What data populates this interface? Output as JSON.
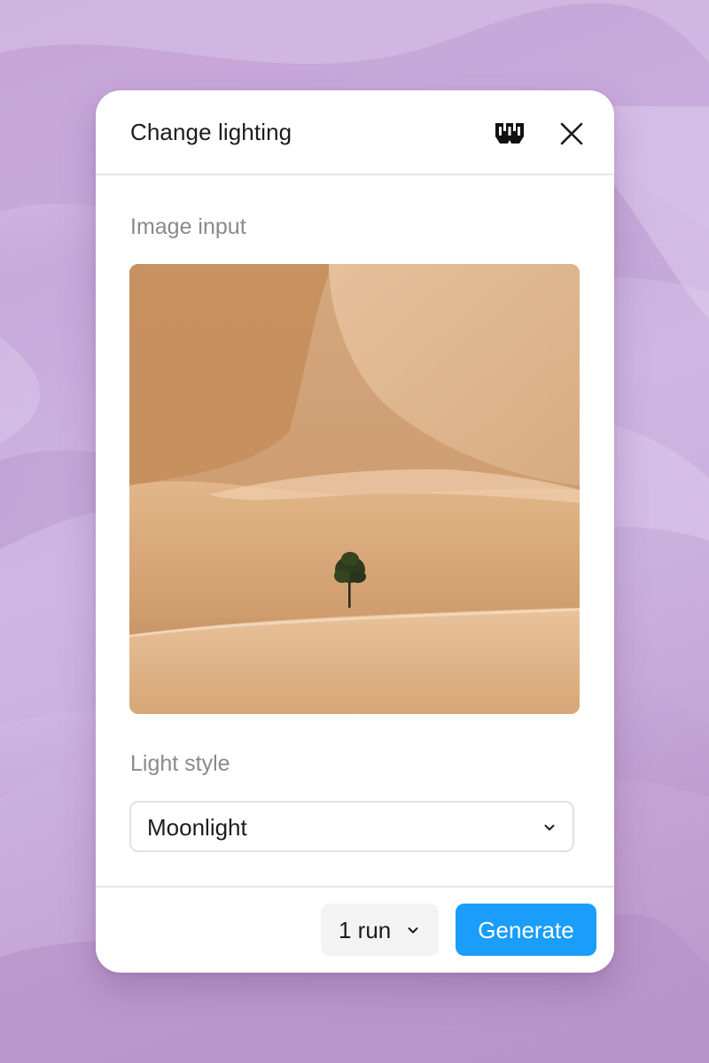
{
  "dialog": {
    "title": "Change lighting",
    "brand_icon": "w-logo-icon",
    "close_icon": "close-icon"
  },
  "image_input": {
    "label": "Image input",
    "image": "desert-dunes-with-lone-tree"
  },
  "light_style": {
    "label": "Light style",
    "selected": "Moonlight",
    "chevron_icon": "chevron-down-icon"
  },
  "footer": {
    "runs_label": "1 run",
    "runs_chevron_icon": "chevron-down-icon",
    "generate_label": "Generate"
  },
  "colors": {
    "accent": "#1a9dfb",
    "background": "#c8aadb",
    "card": "#ffffff"
  }
}
